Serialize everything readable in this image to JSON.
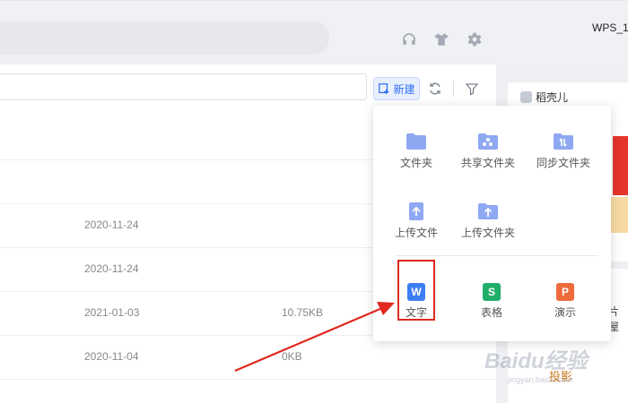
{
  "topbar": {
    "account_name": "WPS_1",
    "icons": [
      "headset-icon",
      "tshirt-icon",
      "gear-icon"
    ]
  },
  "toolbar": {
    "new_label": "新建",
    "icons": [
      "add-file-icon",
      "refresh-icon",
      "filter-icon"
    ]
  },
  "files": {
    "rows": [
      {
        "date": "2020-11-24",
        "size": ""
      },
      {
        "date": "2020-11-24",
        "size": ""
      },
      {
        "date": "2021-01-03",
        "size": "10.75KB"
      },
      {
        "date": "2020-11-04",
        "size": "0KB"
      }
    ]
  },
  "new_menu": {
    "folders": [
      {
        "label": "文件夹"
      },
      {
        "label": "共享文件夹"
      },
      {
        "label": "同步文件夹"
      }
    ],
    "uploads": [
      {
        "label": "上传文件"
      },
      {
        "label": "上传文件夹"
      }
    ],
    "documents": [
      {
        "label": "文字",
        "glyph": "W",
        "color": "#3d7ef5"
      },
      {
        "label": "表格",
        "glyph": "S",
        "color": "#21ad6b"
      },
      {
        "label": "演示",
        "glyph": "P",
        "color": "#ee6b3b"
      }
    ]
  },
  "right_panel": {
    "title": "稻壳儿",
    "text1": "片屋",
    "text2": "投影"
  },
  "watermark": {
    "main": "Baidu经验",
    "sub": "jingyan.baidu.com"
  },
  "colors": {
    "accent": "#2e6ff2",
    "folder": "#8fa8f2",
    "annotation_red": "#e0281f"
  }
}
